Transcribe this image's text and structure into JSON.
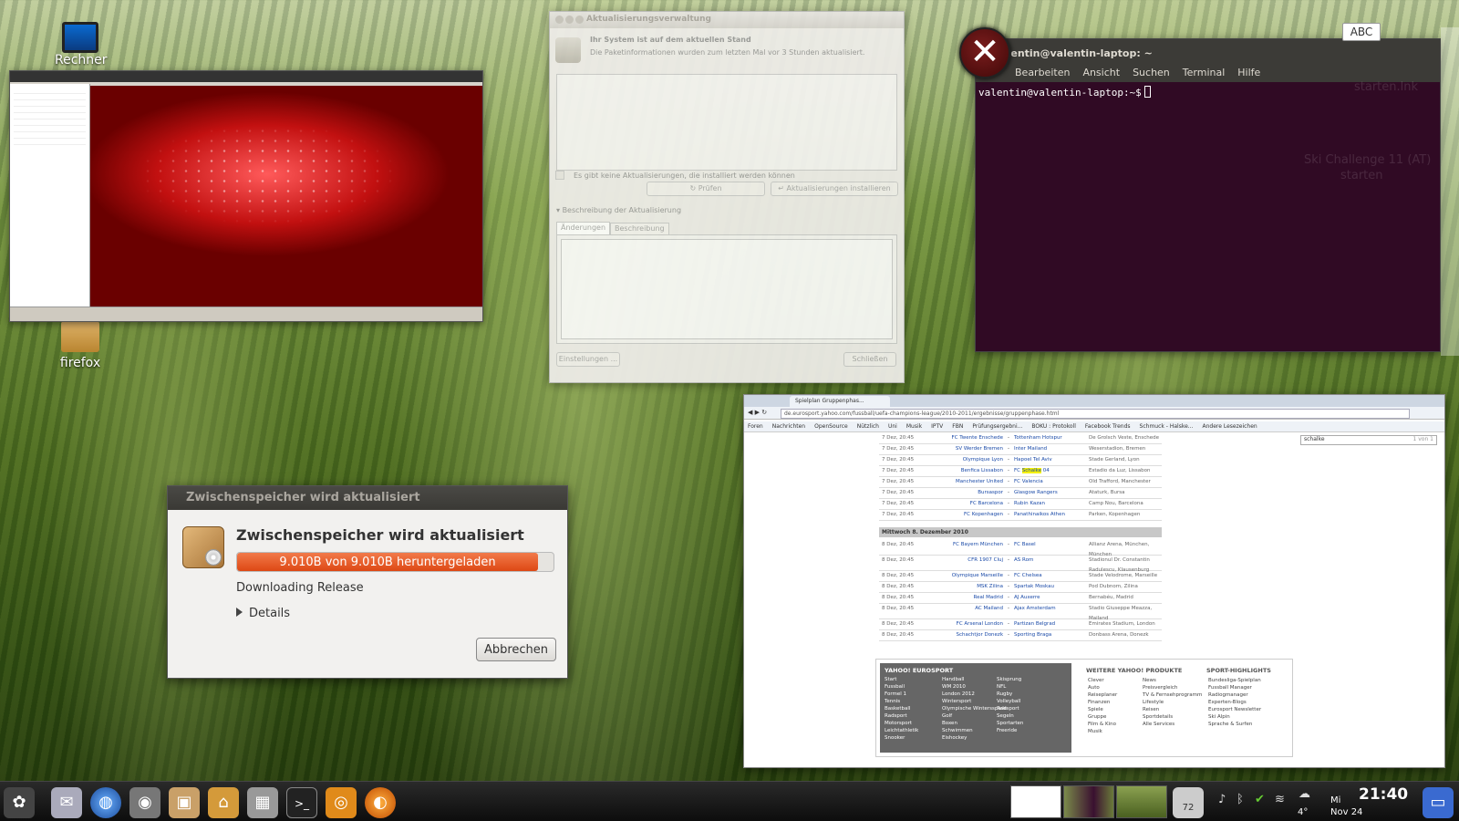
{
  "desktop": {
    "icons": [
      {
        "label": "Rechner",
        "icon": "monitor-icon"
      },
      {
        "label": "firefox",
        "icon": "folder-icon"
      }
    ]
  },
  "update_manager": {
    "title": "Aktualisierungsverwaltung",
    "status_heading": "Ihr System ist auf dem aktuellen Stand",
    "status_detail": "Die Paketinformationen wurden zum letzten Mal vor 3 Stunden aktualisiert.",
    "no_updates": "Es gibt keine Aktualisierungen, die installiert werden können",
    "check_button": "Prüfen",
    "install_button": "Aktualisierungen installieren",
    "description_toggle": "Beschreibung der Aktualisierung",
    "tabs": [
      "Änderungen",
      "Beschreibung"
    ],
    "settings_button": "Einstellungen ...",
    "close_button": "Schließen"
  },
  "terminal": {
    "title": "valentin@valentin-laptop: ~",
    "menu": [
      "Bearbeiten",
      "Ansicht",
      "Suchen",
      "Terminal",
      "Hilfe"
    ],
    "prompt": "valentin@valentin-laptop:~$",
    "ghost_lines": [
      "starten.lnk",
      "Ski Challenge 11 (AT)",
      "starten"
    ]
  },
  "abc_badge": "ABC",
  "cache_dialog": {
    "title": "Zwischenspeicher wird aktualisiert",
    "heading": "Zwischenspeicher wird aktualisiert",
    "progress_text": "9.010B von 9.010B heruntergeladen",
    "progress_fraction": 1.0,
    "status": "Downloading Release",
    "details_label": "Details",
    "cancel_button": "Abbrechen"
  },
  "browser": {
    "tab_title": "Spielplan Gruppenphas...",
    "url": "de.eurosport.yahoo.com/fussball/uefa-champions-league/2010-2011/ergebnisse/gruppenphase.html",
    "bookmarks": [
      "Foren",
      "Nachrichten",
      "OpenSource",
      "Nützlich",
      "Uni",
      "Musik",
      "IPTV",
      "FBN",
      "Prüfungsergebni...",
      "BOKU : Protokoll",
      "Facebook Trends",
      "Schmuck - Halske...",
      "Andere Lesezeichen"
    ],
    "find_text": "schalke",
    "find_count": "1 von 1",
    "matches_day1": [
      {
        "date": "7 Dez, 20:45",
        "home": "FC Twente Enschede",
        "away": "Tottenham Hotspur",
        "venue": "De Grolsch Veste, Enschede"
      },
      {
        "date": "7 Dez, 20:45",
        "home": "SV Werder Bremen",
        "away": "Inter Mailand",
        "venue": "Weserstadion, Bremen"
      },
      {
        "date": "7 Dez, 20:45",
        "home": "Olympique Lyon",
        "away": "Hapoel Tel Aviv",
        "venue": "Stade Gerland, Lyon"
      },
      {
        "date": "7 Dez, 20:45",
        "home": "Benfica Lissabon",
        "away": "FC Schalke 04",
        "venue": "Estadio da Luz, Lissabon"
      },
      {
        "date": "7 Dez, 20:45",
        "home": "Manchester United",
        "away": "FC Valencia",
        "venue": "Old Trafford, Manchester"
      },
      {
        "date": "7 Dez, 20:45",
        "home": "Bursaspor",
        "away": "Glasgow Rangers",
        "venue": "Ataturk, Bursa"
      },
      {
        "date": "7 Dez, 20:45",
        "home": "FC Barcelona",
        "away": "Rubin Kazan",
        "venue": "Camp Nou, Barcelona"
      },
      {
        "date": "7 Dez, 20:45",
        "home": "FC Kopenhagen",
        "away": "Panathinaikos Athen",
        "venue": "Parken, Kopenhagen"
      }
    ],
    "day2_header": "Mittwoch 8. Dezember 2010",
    "matches_day2": [
      {
        "date": "8 Dez, 20:45",
        "home": "FC Bayern München",
        "away": "FC Basel",
        "venue": "Allianz Arena, München, München"
      },
      {
        "date": "8 Dez, 20:45",
        "home": "CFR 1907 Cluj",
        "away": "AS Rom",
        "venue": "Stadionul Dr. Constantin Radulescu, Klausenburg"
      },
      {
        "date": "8 Dez, 20:45",
        "home": "Olympique Marseille",
        "away": "FC Chelsea",
        "venue": "Stade Velodrome, Marseille"
      },
      {
        "date": "8 Dez, 20:45",
        "home": "MSK Zilina",
        "away": "Spartak Moskau",
        "venue": "Pod Dubnom, Zilina"
      },
      {
        "date": "8 Dez, 20:45",
        "home": "Real Madrid",
        "away": "AJ Auxerre",
        "venue": "Bernabéu, Madrid"
      },
      {
        "date": "8 Dez, 20:45",
        "home": "AC Mailand",
        "away": "Ajax Amsterdam",
        "venue": "Stadio Giuseppe Meazza, Mailand"
      },
      {
        "date": "8 Dez, 20:45",
        "home": "FC Arsenal London",
        "away": "Partizan Belgrad",
        "venue": "Emirates Stadium, London"
      },
      {
        "date": "8 Dez, 20:45",
        "home": "Schachtjor Donezk",
        "away": "Sporting Braga",
        "venue": "Donbass Arena, Donezk"
      }
    ],
    "footer": {
      "eurosport_title": "YAHOO! EUROSPORT",
      "eurosport_col1": [
        "Start",
        "Fussball",
        "Formel 1",
        "Tennis",
        "Basketball",
        "Radsport",
        "Motorsport",
        "Leichtathletik",
        "Snooker"
      ],
      "eurosport_col2": [
        "Handball",
        "WM 2010",
        "London 2012",
        "Wintersport",
        "Olympische Wintersspiele",
        "Golf",
        "Boxen",
        "Schwimmen",
        "Eishockey"
      ],
      "eurosport_col3": [
        "Skisprung",
        "NFL",
        "Rugby",
        "Volleyball",
        "Radsport",
        "Segeln",
        "Sportarten",
        "Freeride"
      ],
      "products_title": "WEITERE YAHOO! PRODUKTE",
      "products_col1": [
        "Clever",
        "Auto",
        "Reiseplaner",
        "Finanzen",
        "Spiele",
        "Gruppe",
        "Film & Kino",
        "Musik"
      ],
      "products_col2": [
        "News",
        "Preisvergleich",
        "TV & Fernsehprogramm",
        "Lifestyle",
        "Reisen",
        "Sportdetails",
        "Alle Services"
      ],
      "highlights_title": "SPORT-HIGHLIGHTS",
      "highlights": [
        "Bundesliga-Spielplan",
        "Fussball Manager",
        "Radiogmanager",
        "Experten-Blogs",
        "Eurosport Newsletter",
        "Ski Alpin",
        "Sprache & Surfen"
      ]
    }
  },
  "taskbar": {
    "launchers": [
      "gnome-foot-icon",
      "mail-icon",
      "browser-globe-icon",
      "speaker-icon",
      "software-center-icon",
      "home-folder-icon",
      "calculator-icon",
      "terminal-icon",
      "media-player-icon",
      "firefox-icon"
    ],
    "badge_count": "72",
    "weather_temp": "4°",
    "date_day": "Mi",
    "date_md": "Nov 24",
    "clock": "21:40"
  }
}
